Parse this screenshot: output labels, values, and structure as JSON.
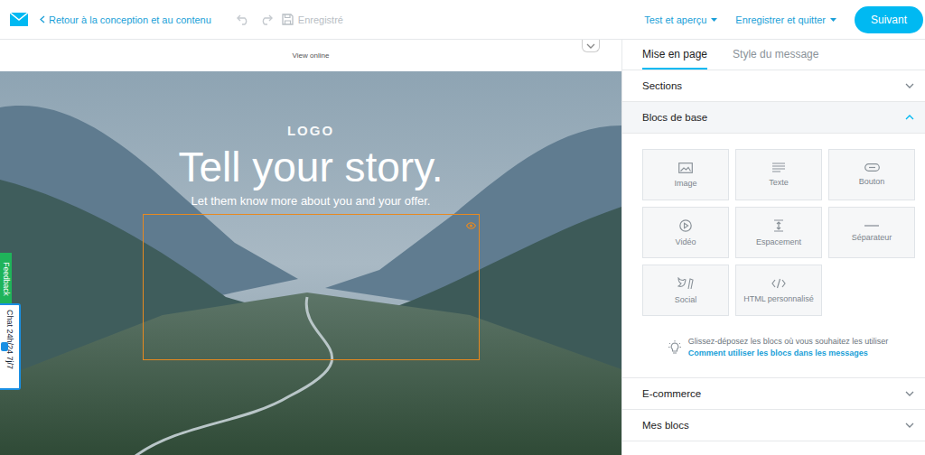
{
  "header": {
    "back_link": "Retour à la conception et au contenu",
    "undo": {
      "disabled": true
    },
    "redo": {
      "disabled": true
    },
    "save_status": {
      "label": "Enregistré",
      "disabled": true
    },
    "menus": [
      "Test et aperçu",
      "Enregistrer et quitter"
    ],
    "next_button": "Suivant"
  },
  "canvas": {
    "view_online": "View online",
    "hero": {
      "logo": "LOGO",
      "title": "Tell your story.",
      "subtitle": "Let them know more about you and your offer."
    },
    "selected_block": {
      "selected": true
    }
  },
  "side_tabs": [
    {
      "label": "Feedback",
      "color": "#1fb35a"
    },
    {
      "label": "Chat 24h/24 7j/7",
      "color": "#1a8fe3"
    }
  ],
  "panel": {
    "tabs": [
      {
        "label": "Mise en page",
        "selected": true
      },
      {
        "label": "Style du message",
        "selected": false
      }
    ],
    "sections": [
      {
        "label": "Sections",
        "expanded": false
      },
      {
        "label": "Blocs de base",
        "expanded": true,
        "blocks": [
          "Image",
          "Texte",
          "Bouton",
          "Vidéo",
          "Espacement",
          "Séparateur",
          "Social",
          "HTML personnalisé"
        ],
        "hint": "Glissez-déposez les blocs où vous souhaitez les utiliser",
        "link": "Comment utiliser les blocs dans les messages"
      },
      {
        "label": "E-commerce",
        "expanded": false
      },
      {
        "label": "Mes blocs",
        "expanded": false
      }
    ]
  }
}
